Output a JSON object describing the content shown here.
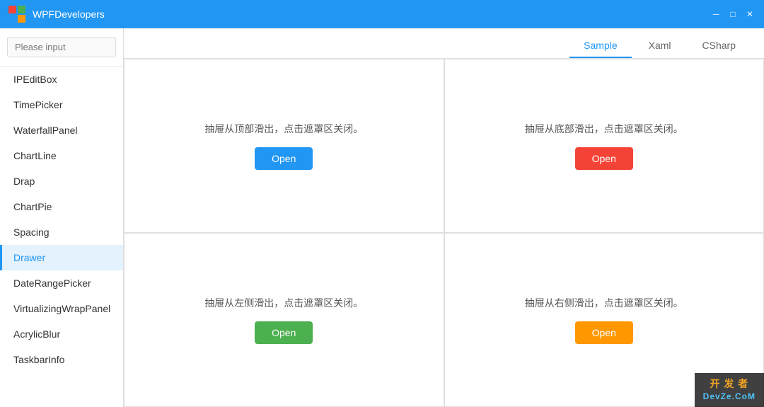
{
  "titleBar": {
    "title": "WPFDevelopers",
    "minimizeLabel": "─",
    "maximizeLabel": "□",
    "closeLabel": "✕"
  },
  "sidebar": {
    "searchPlaceholder": "Please input",
    "items": [
      {
        "id": "IPEditBox",
        "label": "IPEditBox",
        "active": false
      },
      {
        "id": "TimePicker",
        "label": "TimePicker",
        "active": false
      },
      {
        "id": "WaterfallPanel",
        "label": "WaterfallPanel",
        "active": false
      },
      {
        "id": "ChartLine",
        "label": "ChartLine",
        "active": false
      },
      {
        "id": "Drap",
        "label": "Drap",
        "active": false
      },
      {
        "id": "ChartPie",
        "label": "ChartPie",
        "active": false
      },
      {
        "id": "Spacing",
        "label": "Spacing",
        "active": false
      },
      {
        "id": "Drawer",
        "label": "Drawer",
        "active": true
      },
      {
        "id": "DateRangePicker",
        "label": "DateRangePicker",
        "active": false
      },
      {
        "id": "VirtualizingWrapPanel",
        "label": "VirtualizingWrapPanel",
        "active": false
      },
      {
        "id": "AcrylicBlur",
        "label": "AcrylicBlur",
        "active": false
      },
      {
        "id": "TaskbarInfo",
        "label": "TaskbarInfo",
        "active": false
      }
    ]
  },
  "tabs": [
    {
      "id": "sample",
      "label": "Sample",
      "active": true
    },
    {
      "id": "xaml",
      "label": "Xaml",
      "active": false
    },
    {
      "id": "csharp",
      "label": "CSharp",
      "active": false
    }
  ],
  "panels": [
    {
      "id": "top-left",
      "text": "抽屉从顶部滑出，点击遮罩区关闭。",
      "buttonLabel": "Open",
      "buttonColor": "btn-blue"
    },
    {
      "id": "top-right",
      "text": "抽屉从底部滑出，点击遮罩区关闭。",
      "buttonLabel": "Open",
      "buttonColor": "btn-red"
    },
    {
      "id": "bottom-left",
      "text": "抽屉从左侧滑出，点击遮罩区关闭。",
      "buttonLabel": "Open",
      "buttonColor": "btn-green"
    },
    {
      "id": "bottom-right",
      "text": "抽屉从右侧滑出，点击遮罩区关闭。",
      "buttonLabel": "Open",
      "buttonColor": "btn-orange"
    }
  ],
  "watermark": {
    "line1": "开 发 者",
    "line2": "DevZe.CoM"
  }
}
